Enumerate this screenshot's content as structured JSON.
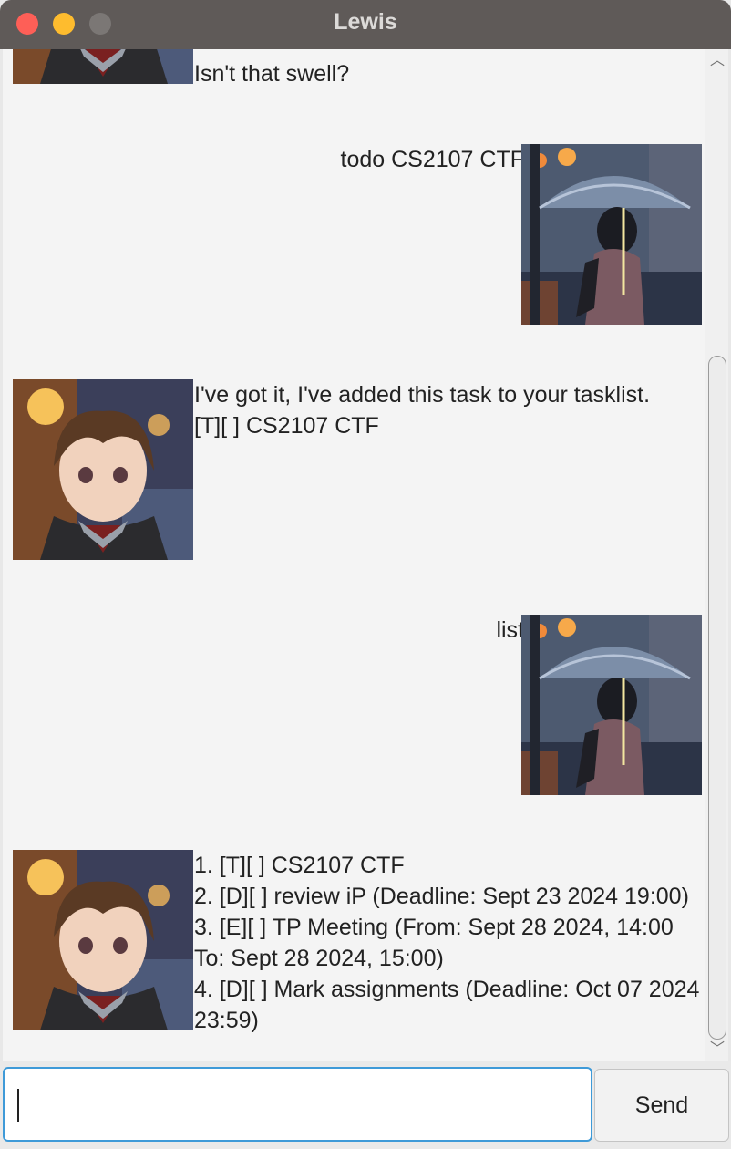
{
  "window": {
    "title": "Lewis"
  },
  "messages": [
    {
      "from": "lewis",
      "text": "Isn't that swell?"
    },
    {
      "from": "user",
      "text": "todo CS2107 CTF"
    },
    {
      "from": "lewis",
      "text": "I've got it, I've added this task to your tasklist.\n[T][ ] CS2107 CTF"
    },
    {
      "from": "user",
      "text": "list"
    },
    {
      "from": "lewis",
      "text": "1. [T][ ] CS2107 CTF\n2. [D][ ] review iP (Deadline: Sept 23 2024 19:00)\n3. [E][ ] TP Meeting (From: Sept 28 2024, 14:00\nTo: Sept 28 2024, 15:00)\n4. [D][ ] Mark assignments (Deadline: Oct 07 2024\n23:59)"
    }
  ],
  "input": {
    "value": "",
    "placeholder": ""
  },
  "send_button": {
    "label": "Send"
  },
  "colors": {
    "titlebar": "#5f5a58",
    "chat_bg": "#f4f4f4",
    "input_focus": "#3e9ad8"
  }
}
